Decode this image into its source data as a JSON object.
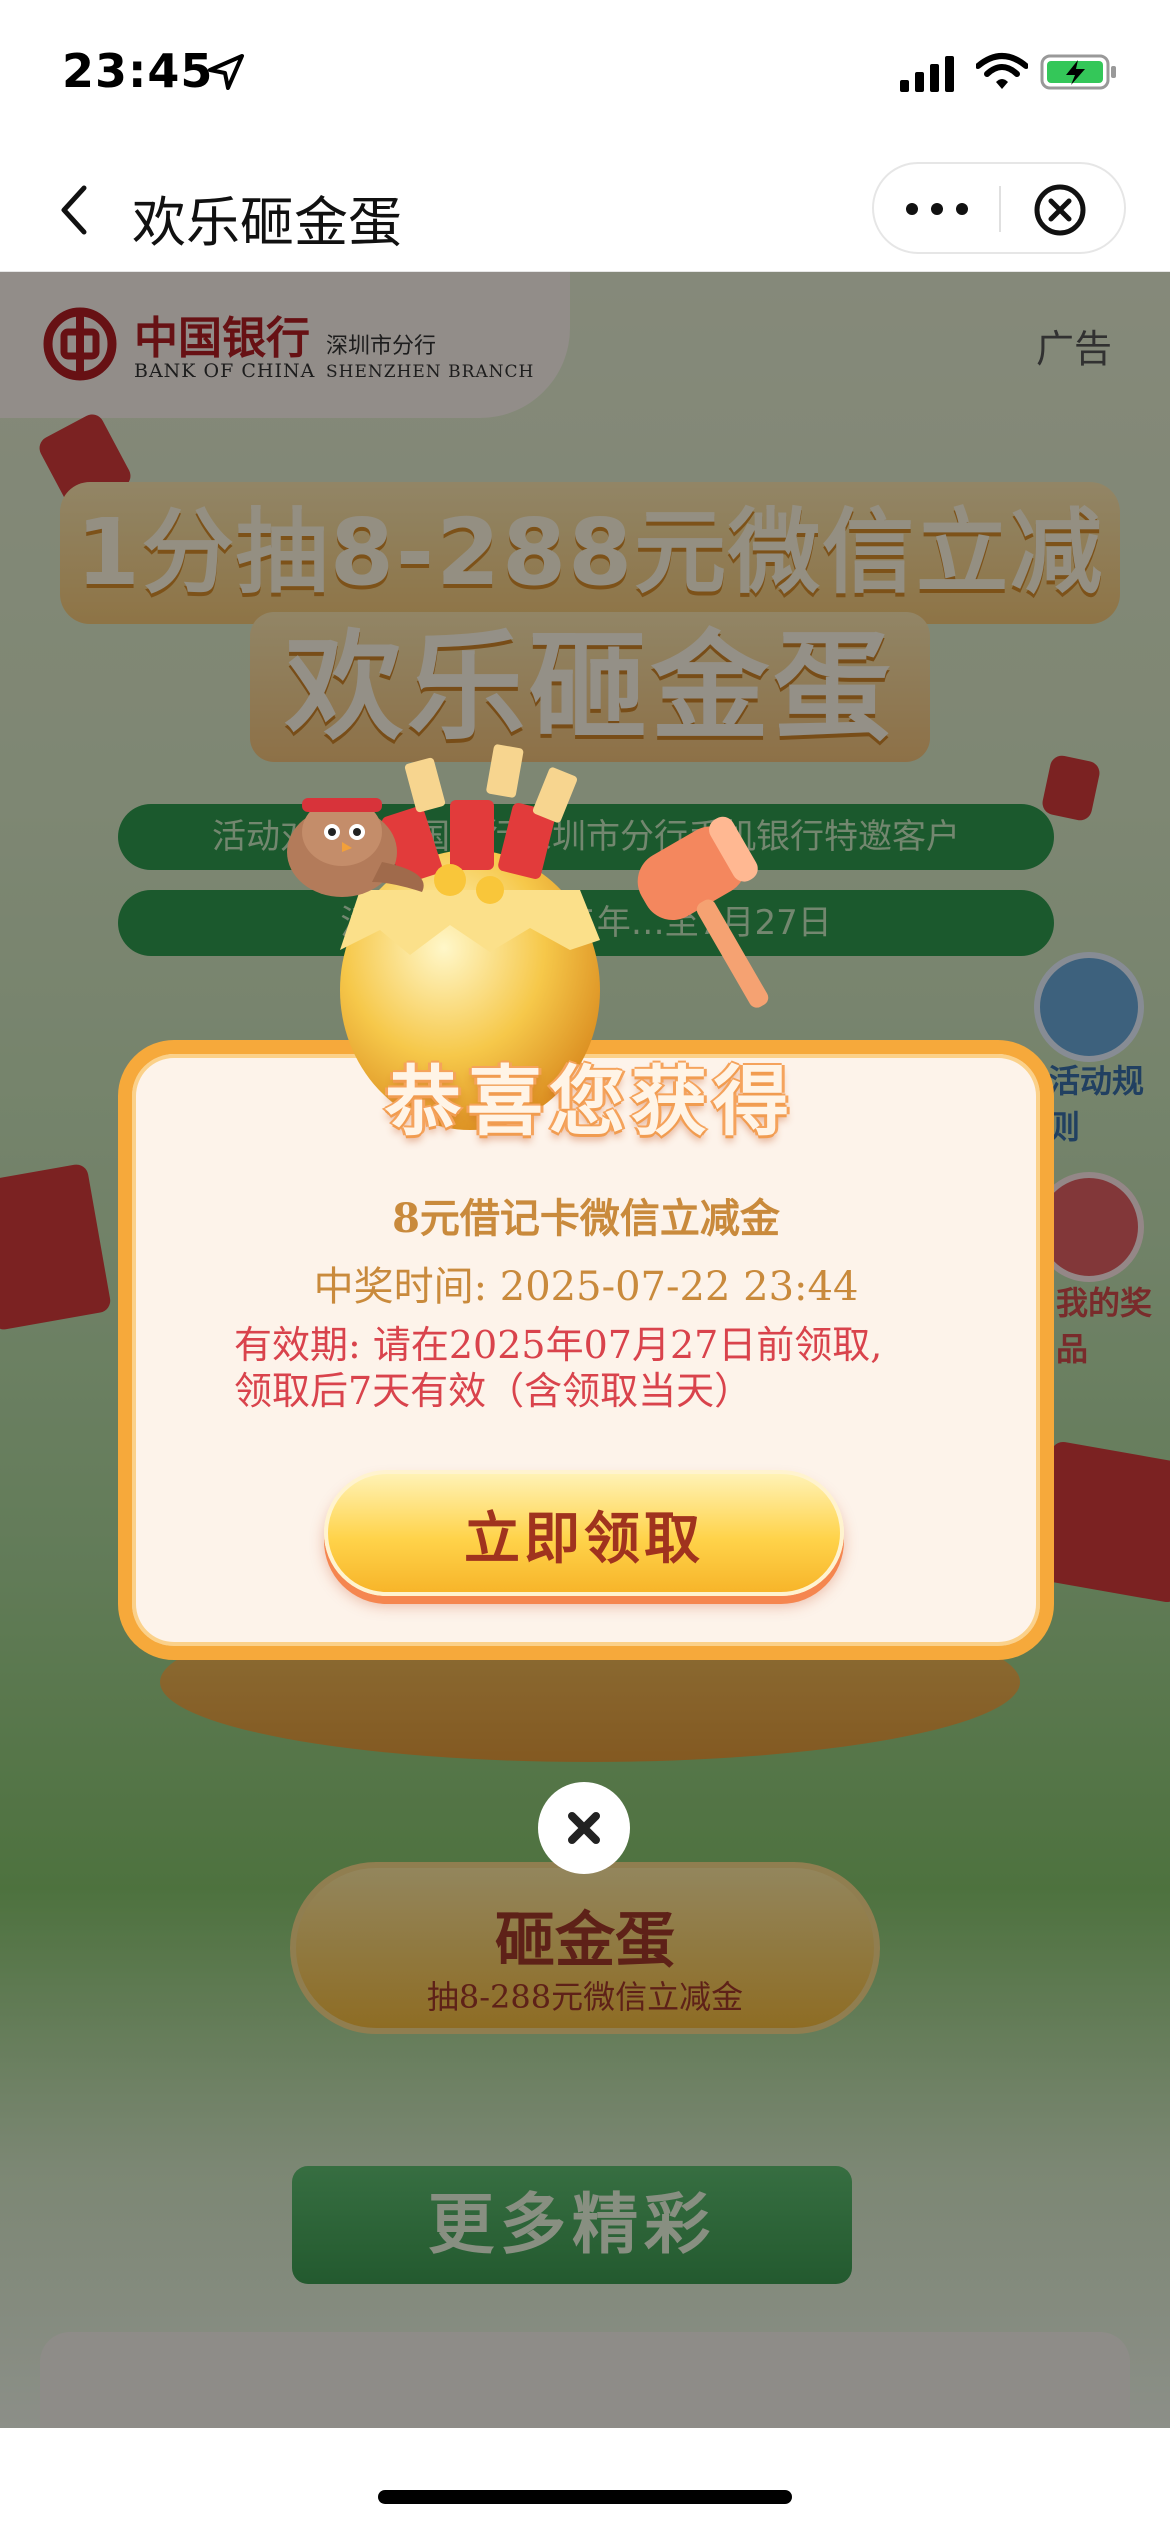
{
  "status_bar": {
    "time": "23:45",
    "icons": [
      "location-arrow-icon",
      "signal-icon",
      "wifi-icon",
      "battery-charging-icon"
    ]
  },
  "nav": {
    "title": "欢乐砸金蛋",
    "back_icon": "chevron-left-icon",
    "more_icon": "more-dots-icon",
    "close_icon": "close-circle-icon"
  },
  "page": {
    "brand": {
      "name_cn": "中国银行",
      "name_en": "BANK OF CHINA",
      "branch_cn": "深圳市分行",
      "branch_en": "SHENZHEN BRANCH"
    },
    "ad_label": "广告",
    "headline_line1": "1分抽8-288元微信立减金",
    "headline_line2": "欢乐砸金蛋",
    "info_pill_1": "活动对象：中国银行深圳市分行手机银行特邀客户",
    "info_pill_2": "活动时间：2025年…至7月27日",
    "side_rules_label": "活动规则",
    "side_prize_label": "我的奖品",
    "main_button_title": "砸金蛋",
    "main_button_subtitle": "抽8-288元微信立减金",
    "more_section_label": "更多精彩"
  },
  "modal": {
    "heading": "恭喜您获得",
    "prize_name": "8元借记卡微信立减金",
    "win_time": "中奖时间: 2025-07-22 23:44",
    "validity_line1": "有效期: 请在2025年07月27日前领取,",
    "validity_line2": "领取后7天有效（含领取当天）",
    "claim_button": "立即领取",
    "close_icon": "close-x-icon"
  },
  "colors": {
    "modal_border": "#f6a93b",
    "modal_bg": "#fdf3ea",
    "prize_text": "#c98a3c",
    "validity_text": "#d9434c",
    "claim_text": "#a0331e"
  }
}
